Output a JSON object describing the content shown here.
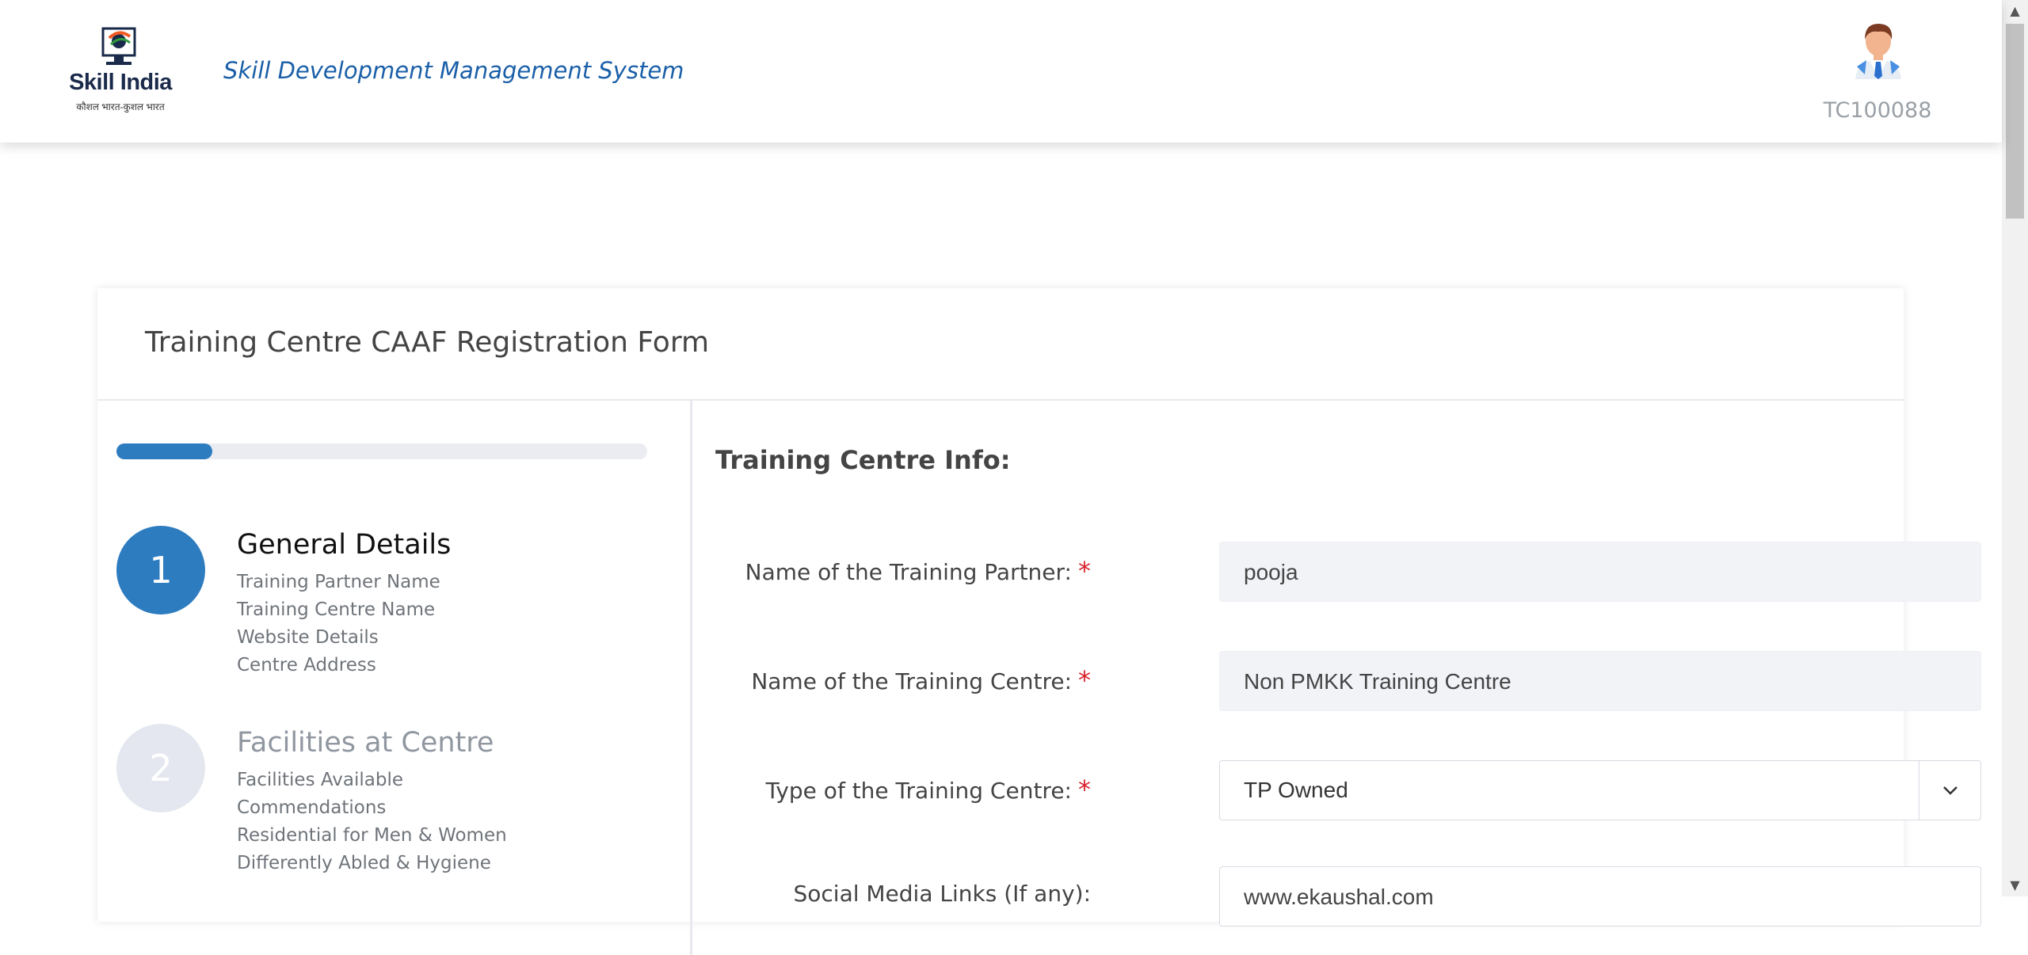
{
  "header": {
    "logo_title": "Skill India",
    "logo_subtitle": "कौशल भारत-कुशल भारत",
    "app_title": "Skill Development Management System",
    "user_id": "TC100088",
    "avatar_icon": "user-avatar-icon"
  },
  "form": {
    "title": "Training Centre CAAF Registration Form",
    "progress": 0.18,
    "accent_color": "#2e7cc0",
    "steps": [
      {
        "number": "1",
        "title": "General Details",
        "items": [
          "Training Partner Name",
          "Training Centre Name",
          "Website Details",
          "Centre Address"
        ]
      },
      {
        "number": "2",
        "title": "Facilities at Centre",
        "items": [
          "Facilities Available",
          "Commendations",
          "Residential for Men & Women",
          "Differently Abled & Hygiene"
        ]
      }
    ],
    "section_title": "Training Centre Info:",
    "required_marker": "*",
    "fields": [
      {
        "label": "Name of the Training Partner:",
        "value": "pooja"
      },
      {
        "label": "Name of the Training Centre:",
        "value": "Non PMKK Training Centre"
      },
      {
        "label": "Type of the Training Centre:",
        "value": "TP Owned"
      },
      {
        "label": "Social Media Links (If any):",
        "value": "www.ekaushal.com"
      }
    ]
  }
}
